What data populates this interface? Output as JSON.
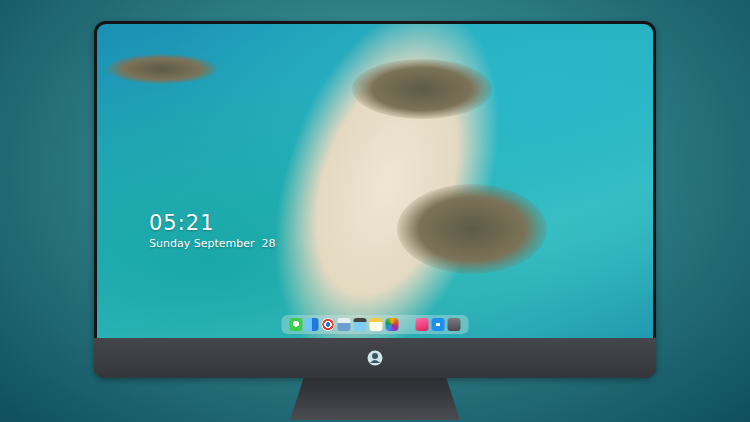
{
  "lock_screen": {
    "time": "05:21",
    "date": "Sunday September  28"
  },
  "dock": {
    "items": [
      {
        "kind": "messages"
      },
      {
        "kind": "finder"
      },
      {
        "kind": "browser"
      },
      {
        "kind": "preview"
      },
      {
        "kind": "video"
      },
      {
        "kind": "notes"
      },
      {
        "kind": "photos"
      },
      {
        "kind": "music"
      },
      {
        "kind": "appstore"
      },
      {
        "kind": "screenshot"
      }
    ]
  }
}
